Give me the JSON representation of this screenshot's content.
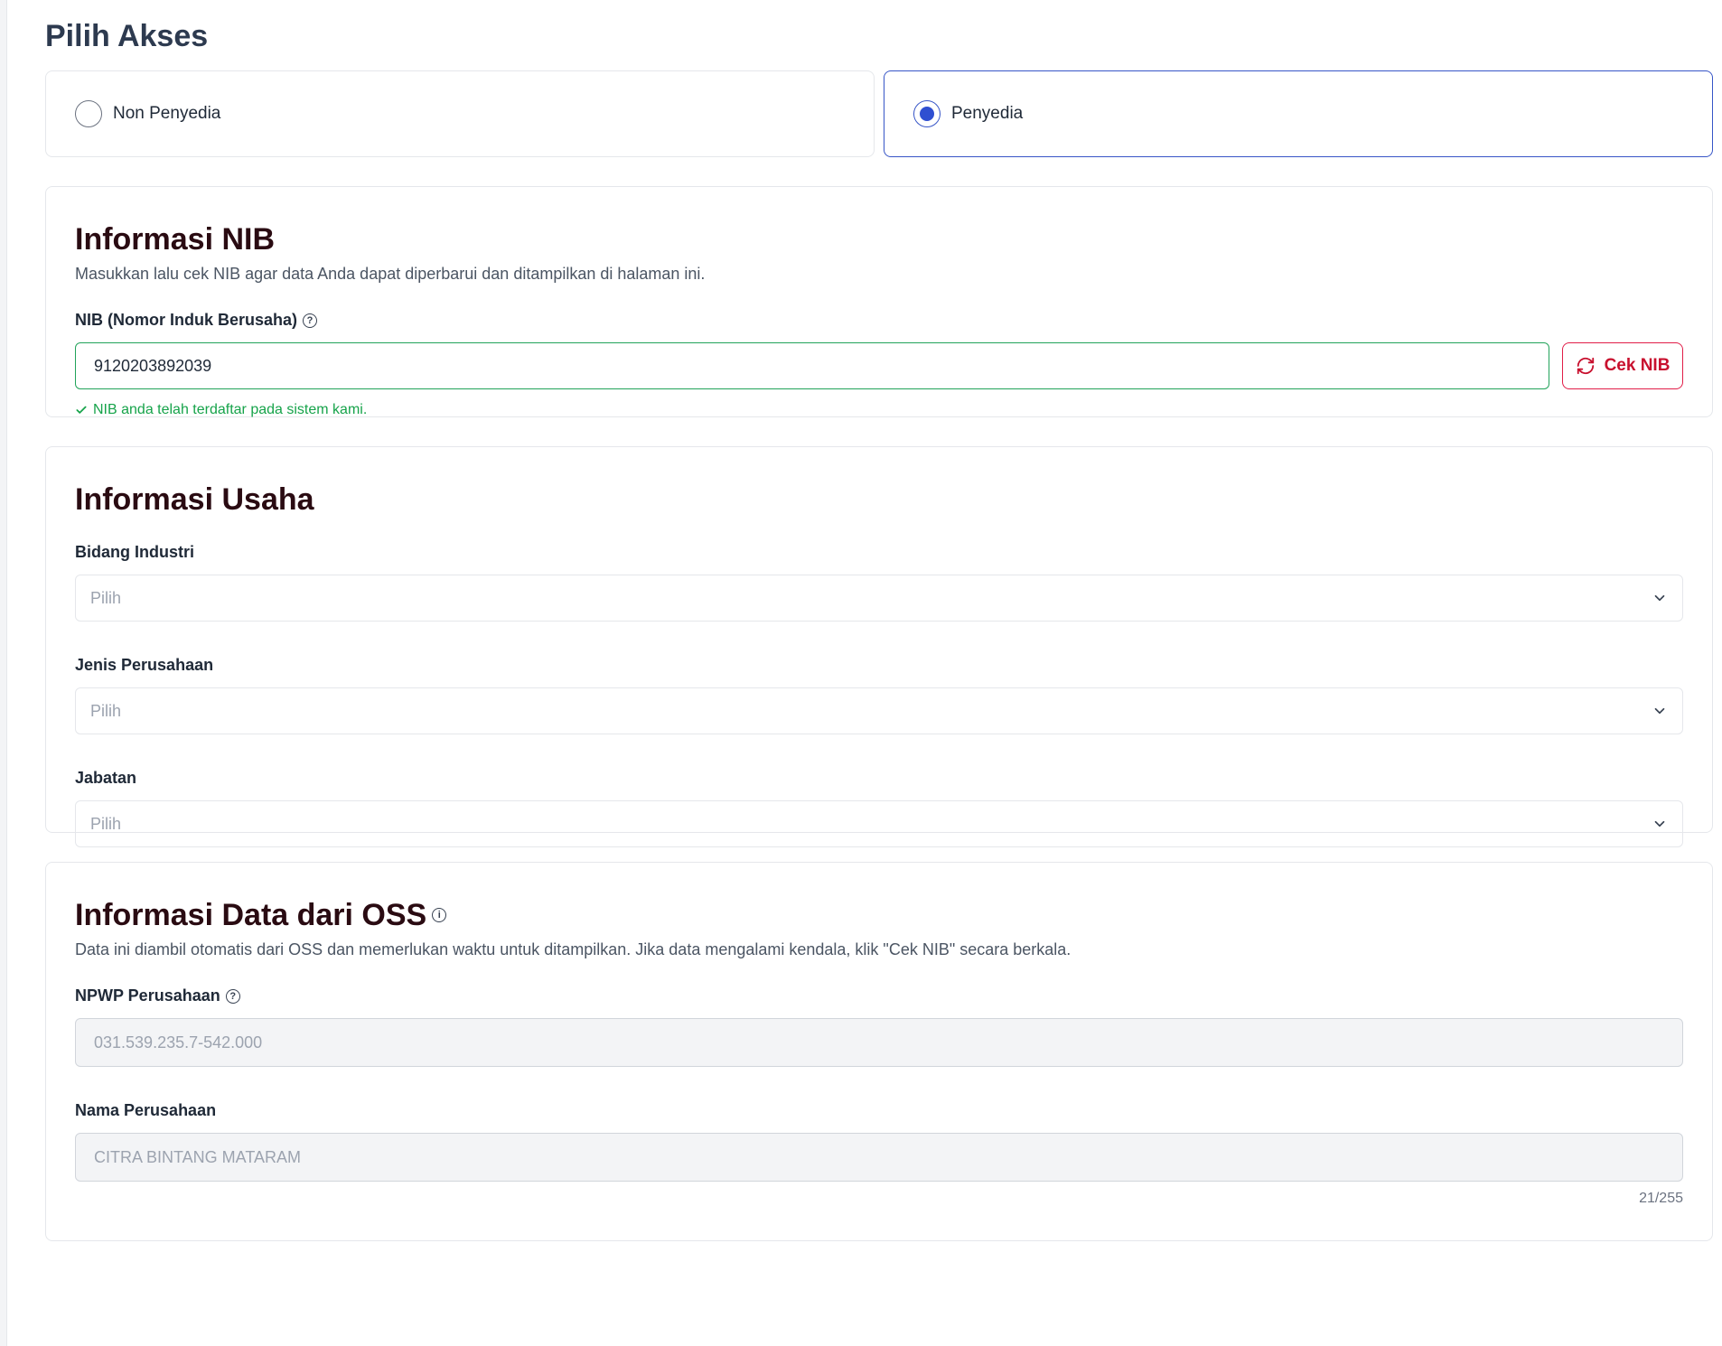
{
  "page": {
    "title": "Pilih Akses"
  },
  "access": {
    "options": [
      {
        "label": "Non Penyedia",
        "selected": false
      },
      {
        "label": "Penyedia",
        "selected": true
      }
    ]
  },
  "nib_section": {
    "title": "Informasi NIB",
    "description": "Masukkan lalu cek NIB agar data Anda dapat diperbarui dan ditampilkan di halaman ini.",
    "field_label": "NIB (Nomor Induk Berusaha)",
    "value": "9120203892039",
    "button_label": "Cek NIB",
    "success_message": "NIB anda telah terdaftar pada sistem kami."
  },
  "usaha_section": {
    "title": "Informasi Usaha",
    "fields": [
      {
        "label": "Bidang Industri",
        "placeholder": "Pilih"
      },
      {
        "label": "Jenis Perusahaan",
        "placeholder": "Pilih"
      },
      {
        "label": "Jabatan",
        "placeholder": "Pilih"
      }
    ]
  },
  "oss_section": {
    "title": "Informasi Data dari OSS",
    "description": "Data ini diambil otomatis dari OSS dan memerlukan waktu untuk ditampilkan. Jika data mengalami kendala, klik \"Cek NIB\" secara berkala.",
    "npwp_label": "NPWP Perusahaan",
    "npwp_value": "031.539.235.7-542.000",
    "name_label": "Nama Perusahaan",
    "name_value": "CITRA BINTANG MATARAM",
    "name_counter": "21/255"
  },
  "colors": {
    "accent": "#2f4fd1",
    "success": "#16a34a",
    "danger": "#e11d48",
    "heading": "#2a0b12"
  }
}
